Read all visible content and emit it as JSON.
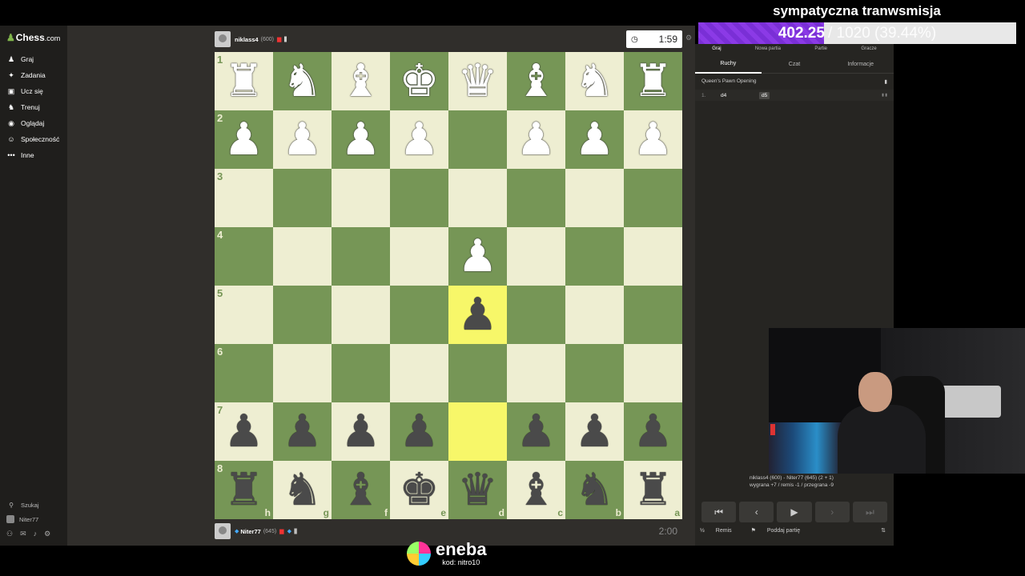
{
  "logo": {
    "mark": "♟",
    "name": "Chess",
    "suffix": ".com"
  },
  "nav": [
    {
      "label": "Graj",
      "icon": "♟",
      "name": "play"
    },
    {
      "label": "Zadania",
      "icon": "✦",
      "name": "puzzles"
    },
    {
      "label": "Ucz się",
      "icon": "▣",
      "name": "learn"
    },
    {
      "label": "Trenuj",
      "icon": "♞",
      "name": "train"
    },
    {
      "label": "Oglądaj",
      "icon": "◉",
      "name": "watch"
    },
    {
      "label": "Społeczność",
      "icon": "☺",
      "name": "community"
    },
    {
      "label": "Inne",
      "icon": "•••",
      "name": "more"
    }
  ],
  "sidebar_bottom": {
    "search": "Szukaj",
    "user": "Niter77"
  },
  "top_player": {
    "name": "niklass4",
    "rating": "(600)",
    "clock": "1:59"
  },
  "bottom_player": {
    "name": "Niter77",
    "rating": "(645)",
    "clock": "2:00"
  },
  "board": {
    "ranks": [
      "1",
      "2",
      "3",
      "4",
      "5",
      "6",
      "7",
      "8"
    ],
    "files": [
      "h",
      "g",
      "f",
      "e",
      "d",
      "c",
      "b",
      "a"
    ],
    "squares": [
      [
        "♜",
        "♞",
        "♝",
        "♚",
        "♛",
        "♝",
        "♞",
        "♜"
      ],
      [
        "♟",
        "♟",
        "♟",
        "♟",
        "",
        "♟",
        "♟",
        "♟"
      ],
      [
        "",
        "",
        "",
        "",
        "",
        "",
        "",
        ""
      ],
      [
        "",
        "",
        "",
        "",
        "♟",
        "",
        "",
        ""
      ],
      [
        "",
        "",
        "",
        "",
        "♟",
        "",
        "",
        ""
      ],
      [
        "",
        "",
        "",
        "",
        "",
        "",
        "",
        ""
      ],
      [
        "♟",
        "♟",
        "♟",
        "♟",
        "",
        "♟",
        "♟",
        "♟"
      ],
      [
        "♜",
        "♞",
        "♝",
        "♚",
        "♛",
        "♝",
        "♞",
        "♜"
      ]
    ],
    "white_rows": [
      0,
      1,
      3
    ],
    "highlights": [
      [
        4,
        4
      ],
      [
        6,
        4
      ]
    ]
  },
  "stream": {
    "title": "sympatyczna tranwsmisja",
    "current": "402.25",
    "rest": "/ 1020 (39.44%)",
    "fraction": 0.3944
  },
  "panel": {
    "tabs": [
      "Graj",
      "Nowa partia",
      "Partie",
      "Gracze"
    ],
    "subtabs": [
      "Ruchy",
      "Czat",
      "Informacje"
    ],
    "opening": "Queen's Pawn Opening",
    "moves": [
      {
        "num": "1.",
        "white": "d4",
        "black": "d5"
      }
    ],
    "result1": "niklass4 (600) - Niter77 (645) (2 + 1)",
    "result2": "wygrana +7 / remis -1 / przegrana -9",
    "draw": "Remis",
    "resign": "Poddaj partię",
    "draw_icon": "½"
  },
  "ad": {
    "brand": "eneba",
    "code": "kod: nitro10"
  }
}
